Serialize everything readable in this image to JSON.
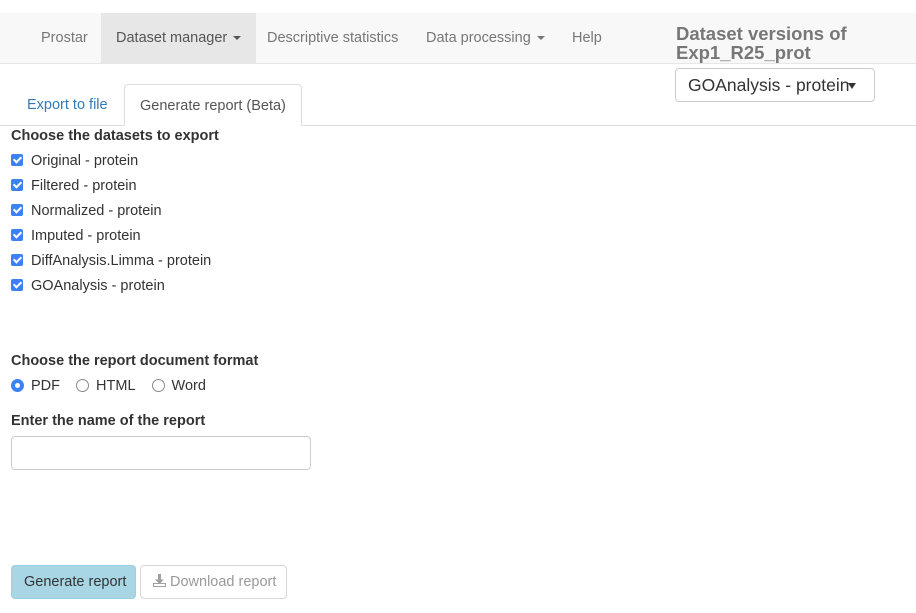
{
  "navbar": {
    "brand": "Prostar",
    "items": [
      {
        "label": "Dataset manager",
        "dropdown": true,
        "active": true
      },
      {
        "label": "Descriptive statistics",
        "dropdown": false
      },
      {
        "label": "Data processing",
        "dropdown": true
      },
      {
        "label": "Help",
        "dropdown": false
      }
    ]
  },
  "versions": {
    "title": "Dataset versions of Exp1_R25_prot",
    "selected": "GOAnalysis - protein"
  },
  "tabs": [
    {
      "label": "Export to file",
      "active": false
    },
    {
      "label": "Generate report (Beta)",
      "active": true
    }
  ],
  "datasets": {
    "label": "Choose the datasets to export",
    "items": [
      {
        "label": "Original - protein",
        "checked": true
      },
      {
        "label": "Filtered - protein",
        "checked": true
      },
      {
        "label": "Normalized - protein",
        "checked": true
      },
      {
        "label": "Imputed - protein",
        "checked": true
      },
      {
        "label": "DiffAnalysis.Limma - protein",
        "checked": true
      },
      {
        "label": "GOAnalysis - protein",
        "checked": true
      }
    ]
  },
  "format": {
    "label": "Choose the report document format",
    "options": [
      {
        "label": "PDF",
        "selected": true
      },
      {
        "label": "HTML",
        "selected": false
      },
      {
        "label": "Word",
        "selected": false
      }
    ]
  },
  "report_name": {
    "label": "Enter the name of the report",
    "value": "",
    "placeholder": ""
  },
  "buttons": {
    "generate": "Generate report",
    "download": "Download report"
  },
  "colors": {
    "accent": "#3b82f6",
    "link": "#337ab7",
    "generate_button": "#a8d6e4"
  }
}
